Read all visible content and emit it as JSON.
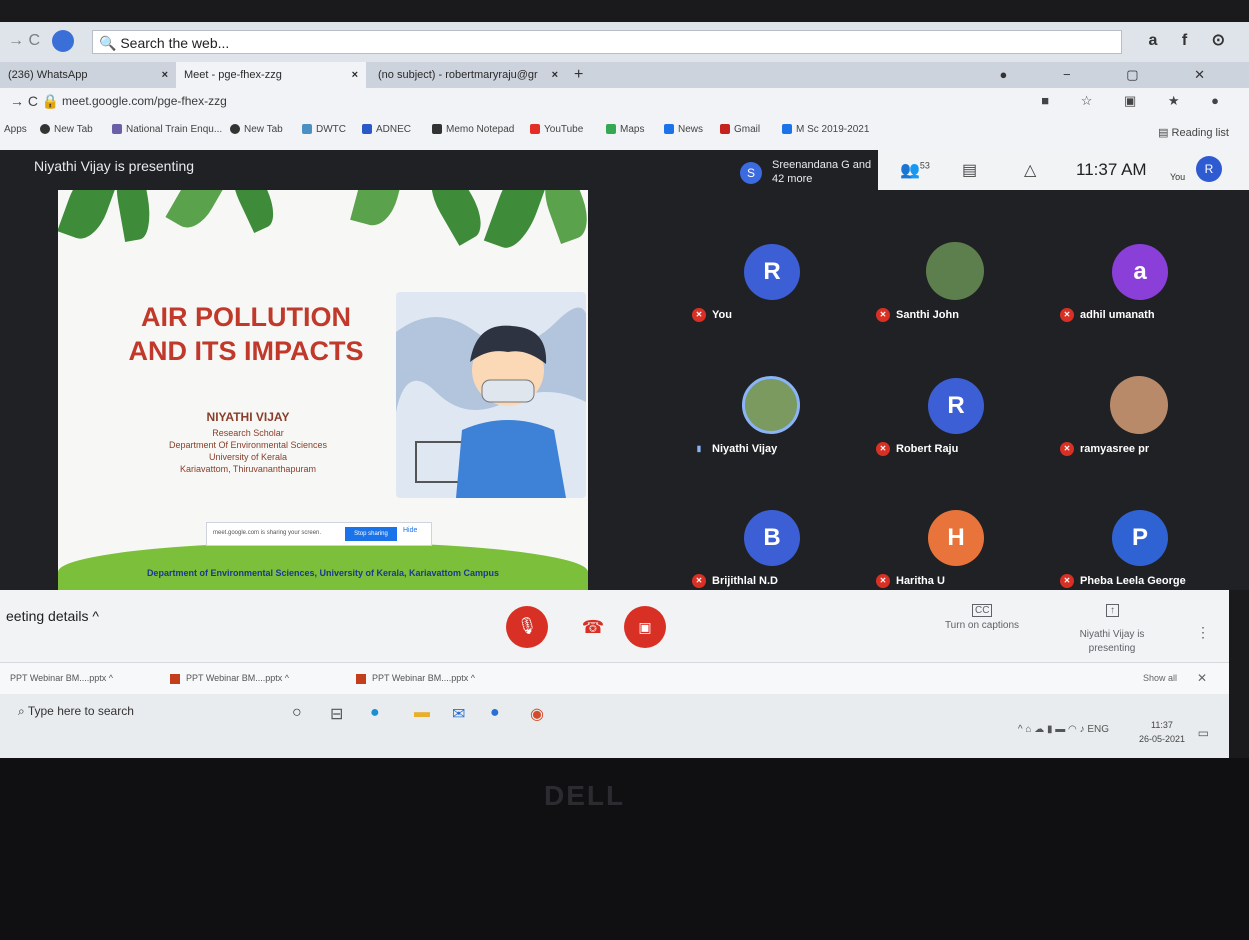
{
  "browser": {
    "top_search_placeholder": "Search the web...",
    "tabs": [
      {
        "label": "(236) WhatsApp",
        "close": "×"
      },
      {
        "label": "Meet - pge-fhex-zzg",
        "close": "×"
      },
      {
        "label": "(no subject) - robertmaryraju@gr",
        "close": "×"
      }
    ],
    "new_tab": "+",
    "url": "meet.google.com/pge-fhex-zzg",
    "bookmarks": [
      "Apps",
      "New Tab",
      "National Train Enqu...",
      "New Tab",
      "DWTC",
      "ADNEC",
      "Memo Notepad",
      "YouTube",
      "Maps",
      "News",
      "Gmail",
      "M Sc 2019-2021"
    ],
    "reading_list": "Reading list"
  },
  "meet": {
    "presenting_banner": "Niyathi Vijay is presenting",
    "chip_avatar": "S",
    "chip_text": "Sreenandana G and 42 more",
    "participant_count": "53",
    "clock": "11:37 AM",
    "you_label": "You",
    "you_avatar": "R",
    "meeting_details": "eeting details",
    "captions_label": "Turn on captions",
    "presenting_label": "Niyathi Vijay is presenting"
  },
  "slide": {
    "title": "AIR POLLUTION AND ITS IMPACTS",
    "author": "NIYATHI VIJAY",
    "role": "Research Scholar",
    "dept": "Department Of Environmental Sciences",
    "univ": "University of Kerala",
    "place": "Kariavattom, Thiruvananthapuram",
    "share_notice": "meet.google.com is sharing your screen.",
    "stop_sharing": "Stop sharing",
    "hide": "Hide",
    "footer": "Department of Environmental Sciences, University of Kerala, Kariavattom Campus"
  },
  "participants": [
    {
      "name": "You",
      "avatar": "R",
      "color": "#3c5fd6",
      "muted": true
    },
    {
      "name": "Santhi John",
      "avatar": "",
      "color": "#5d7f4e",
      "muted": true
    },
    {
      "name": "adhil umanath",
      "avatar": "a",
      "color": "#8b3fd9",
      "muted": true
    },
    {
      "name": "Niyathi Vijay",
      "avatar": "",
      "color": "#7a9a60",
      "muted": false
    },
    {
      "name": "Robert Raju",
      "avatar": "R",
      "color": "#3c5fd6",
      "muted": true
    },
    {
      "name": "ramyasree pr",
      "avatar": "",
      "color": "#b88a6a",
      "muted": true
    },
    {
      "name": "Brijithlal N.D",
      "avatar": "B",
      "color": "#3c5fd6",
      "muted": true
    },
    {
      "name": "Haritha U",
      "avatar": "H",
      "color": "#e8743b",
      "muted": true
    },
    {
      "name": "Pheba Leela George",
      "avatar": "P",
      "color": "#2f63d4",
      "muted": true
    }
  ],
  "downloads": {
    "items": [
      "PPT Webinar BM....pptx",
      "PPT Webinar BM....pptx",
      "PPT Webinar BM....pptx"
    ],
    "show_all": "Show all"
  },
  "taskbar": {
    "search_placeholder": "Type here to search",
    "lang": "ENG",
    "time": "11:37",
    "date": "26-05-2021"
  },
  "laptop_brand": "DELL"
}
